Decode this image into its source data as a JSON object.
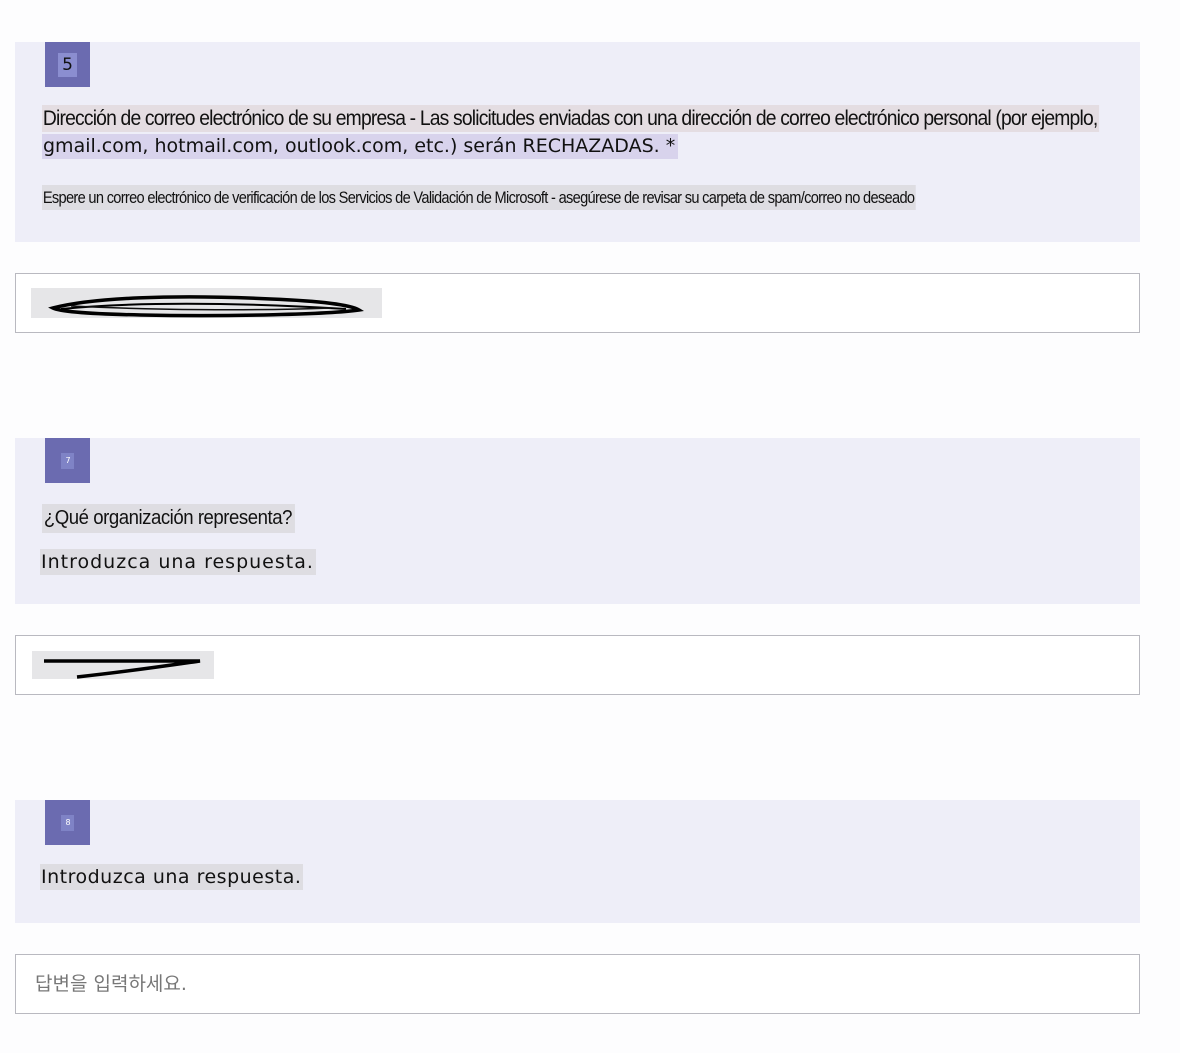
{
  "questions": [
    {
      "number": "5",
      "title_line1": "Dirección de correo electrónico de su empresa - Las solicitudes enviadas con una dirección de correo electrónico personal (por ejemplo,",
      "title_line2": "gmail.com, hotmail.com, outlook.com, etc.) serán RECHAZADAS. *",
      "subtitle": "Espere un correo electrónico de verificación de los Servicios de Validación de Microsoft - asegúrese de revisar su carpeta de spam/correo no deseado"
    },
    {
      "number": "7",
      "title": "¿Qué organización representa?",
      "hint": "Introduzca una respuesta."
    },
    {
      "number": "8",
      "hint": "Introduzca una respuesta.",
      "placeholder": "답변을 입력하세요."
    }
  ]
}
